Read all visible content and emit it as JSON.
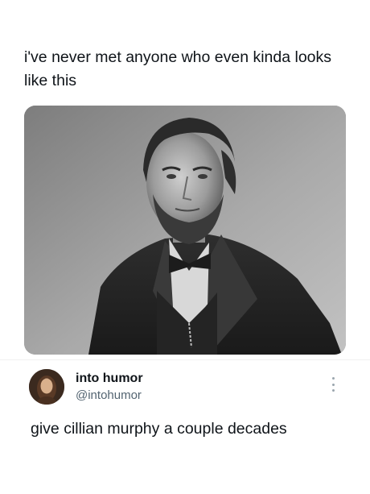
{
  "post": {
    "text": "i've never met anyone who even kinda looks like this",
    "media": {
      "kind": "photo",
      "style": "black-and-white portrait"
    }
  },
  "reply": {
    "display_name": "into humor",
    "handle": "@intohumor",
    "text": "give cillian murphy a couple decades",
    "avatar_icon": "avatar-portrait-icon",
    "more_icon": "more-options-icon"
  },
  "colors": {
    "text_primary": "#0f1419",
    "text_secondary": "#536471",
    "background": "#ffffff"
  }
}
